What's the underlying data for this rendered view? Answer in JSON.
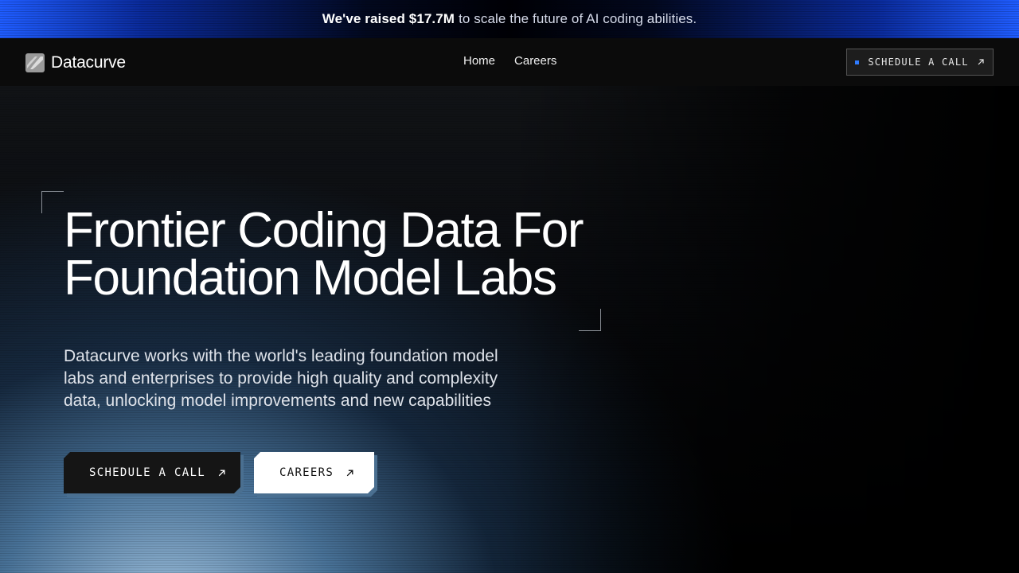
{
  "announcement": {
    "strong": "We've raised $17.7M",
    "rest": "to scale the future of AI coding abilities."
  },
  "nav": {
    "brand": "Datacurve",
    "links": [
      "Home",
      "Careers"
    ],
    "cta": "SCHEDULE A CALL"
  },
  "hero": {
    "title_line1": "Frontier Coding Data For",
    "title_line2": "Foundation Model Labs",
    "description": "Datacurve works with the world's leading foundation model labs and enterprises to provide high quality and complexity data, unlocking model improvements and new capabilities",
    "primary_button": "SCHEDULE A CALL",
    "secondary_button": "CAREERS"
  },
  "icons": {
    "logo": "datacurve-logo-icon",
    "arrow": "arrow-up-right-icon"
  },
  "colors": {
    "accent_blue": "#2f7bff",
    "banner_blue": "#1f5cff",
    "background": "#000000",
    "button_dark": "#151515",
    "button_light": "#ffffff"
  }
}
